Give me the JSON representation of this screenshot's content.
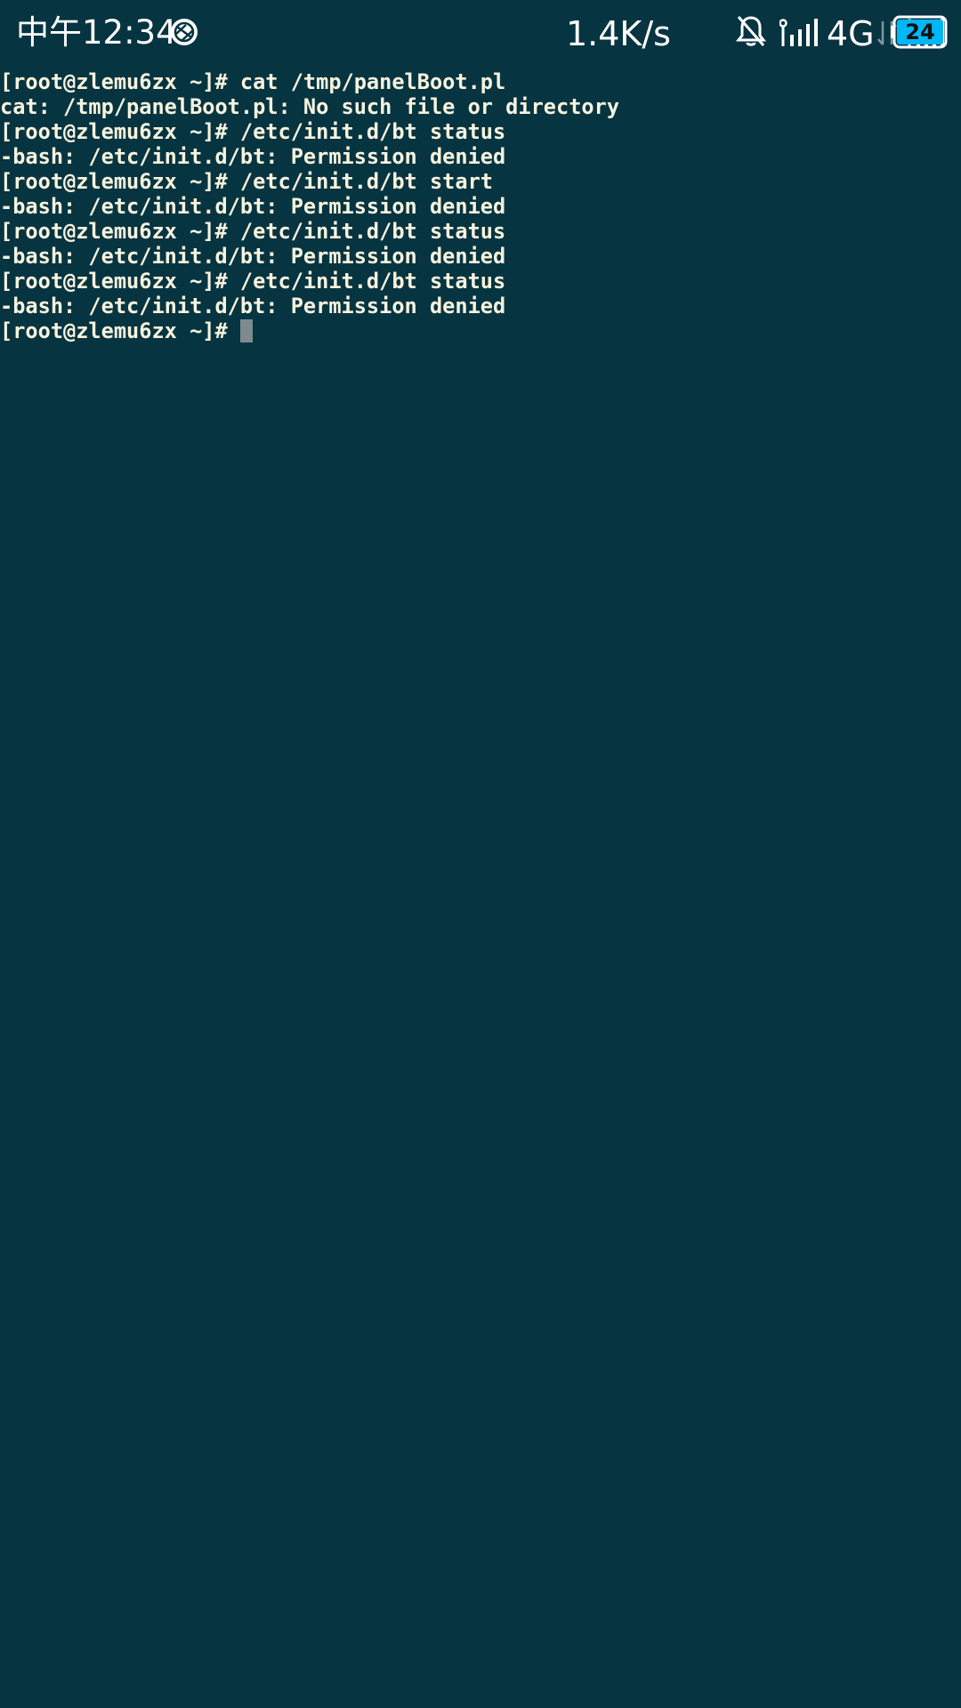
{
  "status_bar": {
    "time": "中午12:34",
    "app_icon": "browser-app-icon",
    "network_speed": "1.4K/s",
    "mute_icon": "bell-muted-icon",
    "signal1_icon": "signal-bars-icon",
    "network_type": "4G",
    "data_arrows_icon": "data-transfer-arrows-icon",
    "signal2_icon": "signal-bars-icon",
    "battery_level": "24",
    "battery_color": "#00b7f5"
  },
  "terminal": {
    "background": "#073441",
    "foreground": "#f7f3dd",
    "lines": [
      "[root@zlemu6zx ~]# cat /tmp/panelBoot.pl",
      "cat: /tmp/panelBoot.pl: No such file or directory",
      "[root@zlemu6zx ~]# /etc/init.d/bt status",
      "-bash: /etc/init.d/bt: Permission denied",
      "[root@zlemu6zx ~]# /etc/init.d/bt start",
      "-bash: /etc/init.d/bt: Permission denied",
      "[root@zlemu6zx ~]# /etc/init.d/bt status",
      "-bash: /etc/init.d/bt: Permission denied",
      "[root@zlemu6zx ~]# /etc/init.d/bt status",
      "-bash: /etc/init.d/bt: Permission denied"
    ],
    "prompt": "[root@zlemu6zx ~]# "
  }
}
